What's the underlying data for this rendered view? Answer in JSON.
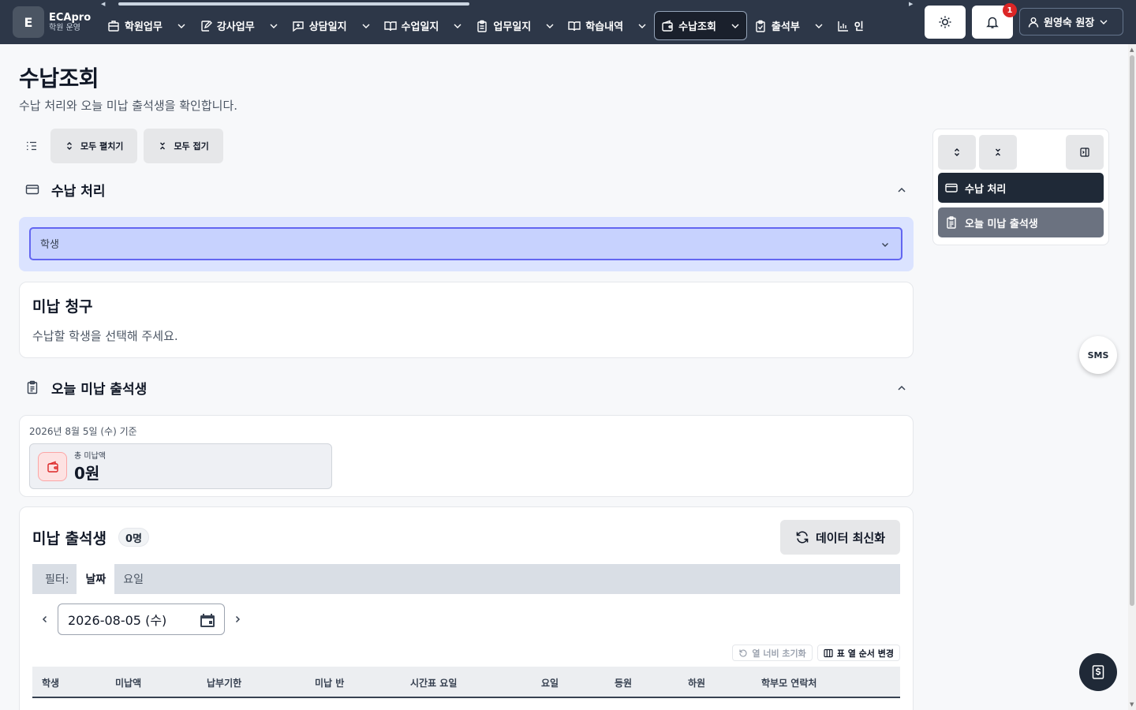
{
  "brand": {
    "logo_letter": "E",
    "name": "ECApro",
    "subtitle": "학원 운영"
  },
  "nav": {
    "items": [
      {
        "label": "학원업무",
        "icon": "building-icon",
        "active": false
      },
      {
        "label": "강사업무",
        "icon": "edit-note-icon",
        "active": false
      },
      {
        "label": "상담일지",
        "icon": "message-plus-icon",
        "active": false
      },
      {
        "label": "수업일지",
        "icon": "book-open-icon",
        "active": false
      },
      {
        "label": "업무일지",
        "icon": "clipboard-icon",
        "active": false
      },
      {
        "label": "학습내역",
        "icon": "book-open-icon",
        "active": false
      },
      {
        "label": "수납조회",
        "icon": "wallet-icon",
        "active": true
      },
      {
        "label": "출석부",
        "icon": "clipboard-check-icon",
        "active": false
      },
      {
        "label": "인",
        "icon": "bar-chart-icon",
        "active": false
      }
    ],
    "notification_count": "1",
    "user_name": "원영숙 원장"
  },
  "page": {
    "title": "수납조회",
    "subtitle": "수납 처리와 오늘 미납 출석생을 확인합니다."
  },
  "toolbar": {
    "expand_all": "모두 펼치기",
    "collapse_all": "모두 접기"
  },
  "payment_section": {
    "title": "수납 처리",
    "student_select_label": "학생",
    "billing_title": "미납 청구",
    "billing_empty": "수납할 학생을 선택해 주세요."
  },
  "unpaid_section": {
    "title": "오늘 미납 출석생",
    "as_of": "2026년 8월 5일 (수) 기준",
    "total_label": "총 미납액",
    "total_value": "0원",
    "list_title": "미납 출석생",
    "count": "0명",
    "refresh_label": "데이터 최신화",
    "filter_label": "필터:",
    "filter_tabs": [
      {
        "label": "날짜",
        "active": true
      },
      {
        "label": "요일",
        "active": false
      }
    ],
    "date_value": "2026-08-05 (수)",
    "reset_widths_label": "열 너비 초기화",
    "column_order_label": "표 열 순서 변경",
    "columns": [
      "학생",
      "미납액",
      "납부기한",
      "미납 반",
      "시간표 요일",
      "요일",
      "등원",
      "하원",
      "학부모 연락처"
    ]
  },
  "side_panel": {
    "items": [
      {
        "label": "수납 처리",
        "active": true
      },
      {
        "label": "오늘 미납 출석생",
        "active": false
      }
    ]
  },
  "floating": {
    "sms_label": "SMS"
  },
  "colors": {
    "topbar": "#2d3748",
    "active_nav": "#1a202c",
    "select_highlight": "#c7d2fe",
    "select_border": "#6366f1",
    "badge_red": "#dc2626"
  }
}
